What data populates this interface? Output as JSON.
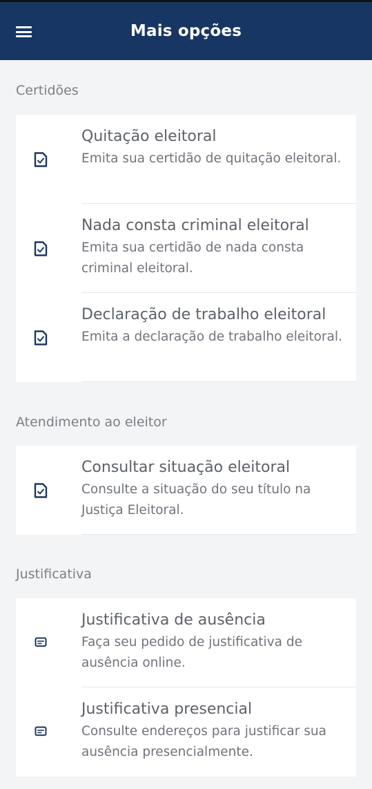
{
  "header": {
    "title": "Mais opções",
    "menu_icon": "hamburger-menu-icon"
  },
  "sections": [
    {
      "label": "Certidões",
      "items": [
        {
          "title": "Quitação eleitoral",
          "description": "Emita sua certidão de quitação eleitoral.",
          "icon": "document-check-icon"
        },
        {
          "title": "Nada consta criminal eleitoral",
          "description": "Emita sua certidão de nada consta criminal eleitoral.",
          "icon": "document-check-icon"
        },
        {
          "title": "Declaração de trabalho eleitoral",
          "description": "Emita a declaração de trabalho eleitoral.",
          "icon": "document-check-icon"
        }
      ]
    },
    {
      "label": "Atendimento ao eleitor",
      "items": [
        {
          "title": "Consultar situação eleitoral",
          "description": "Consulte a situação do seu título na Justiça Eleitoral.",
          "icon": "document-check-icon"
        }
      ]
    },
    {
      "label": "Justificativa",
      "items": [
        {
          "title": "Justificativa de ausência",
          "description": "Faça seu pedido de justificativa de ausência online.",
          "icon": "message-lines-icon"
        },
        {
          "title": "Justificativa presencial",
          "description": "Consulte endereços para justificar sua ausência presencialmente.",
          "icon": "message-lines-icon"
        }
      ]
    }
  ],
  "colors": {
    "header_bg": "#183663",
    "icon": "#1c3660",
    "section_label": "#7b7f86",
    "background": "#f3f4f6"
  }
}
